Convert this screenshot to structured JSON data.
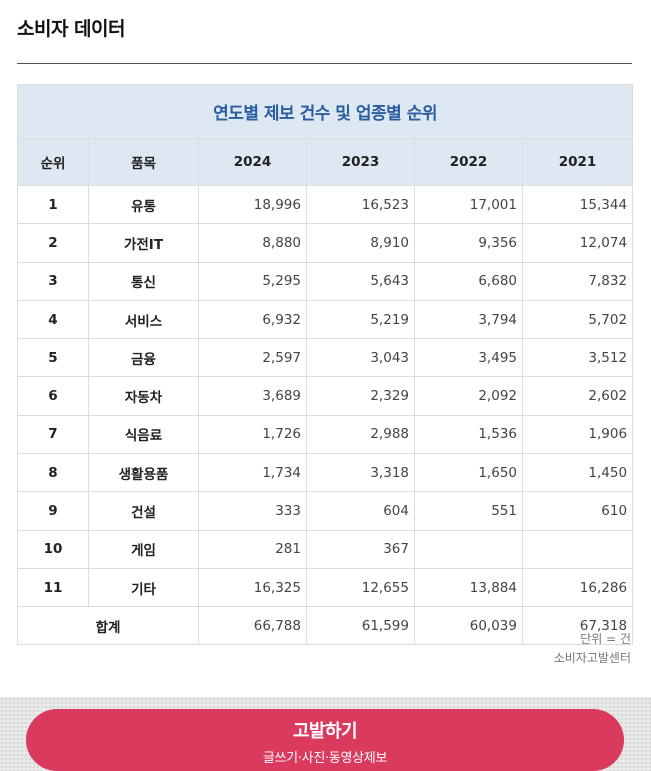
{
  "page": {
    "title": "소비자 데이터"
  },
  "table": {
    "caption": "연도별 제보 건수 및 업종별 순위",
    "headers": [
      "순위",
      "품목",
      "2024",
      "2023",
      "2022",
      "2021"
    ],
    "rows": [
      [
        "1",
        "유통",
        "18,996",
        "16,523",
        "17,001",
        "15,344"
      ],
      [
        "2",
        "가전IT",
        "8,880",
        "8,910",
        "9,356",
        "12,074"
      ],
      [
        "3",
        "통신",
        "5,295",
        "5,643",
        "6,680",
        "7,832"
      ],
      [
        "4",
        "서비스",
        "6,932",
        "5,219",
        "3,794",
        "5,702"
      ],
      [
        "5",
        "금융",
        "2,597",
        "3,043",
        "3,495",
        "3,512"
      ],
      [
        "6",
        "자동차",
        "3,689",
        "2,329",
        "2,092",
        "2,602"
      ],
      [
        "7",
        "식음료",
        "1,726",
        "2,988",
        "1,536",
        "1,906"
      ],
      [
        "8",
        "생활용품",
        "1,734",
        "3,318",
        "1,650",
        "1,450"
      ],
      [
        "9",
        "건설",
        "333",
        "604",
        "551",
        "610"
      ],
      [
        "10",
        "게임",
        "281",
        "367",
        "",
        ""
      ],
      [
        "11",
        "기타",
        "16,325",
        "12,655",
        "13,884",
        "16,286"
      ]
    ],
    "total": {
      "label": "합계",
      "values": [
        "66,788",
        "61,599",
        "60,039",
        "67,318"
      ]
    }
  },
  "notes": {
    "unit": "단위 = 건",
    "source": "소비자고발센터"
  },
  "cta": {
    "label": "고발하기",
    "sub_label": "글쓰기·사진·동영상제보",
    "color": "#d93a5e"
  }
}
